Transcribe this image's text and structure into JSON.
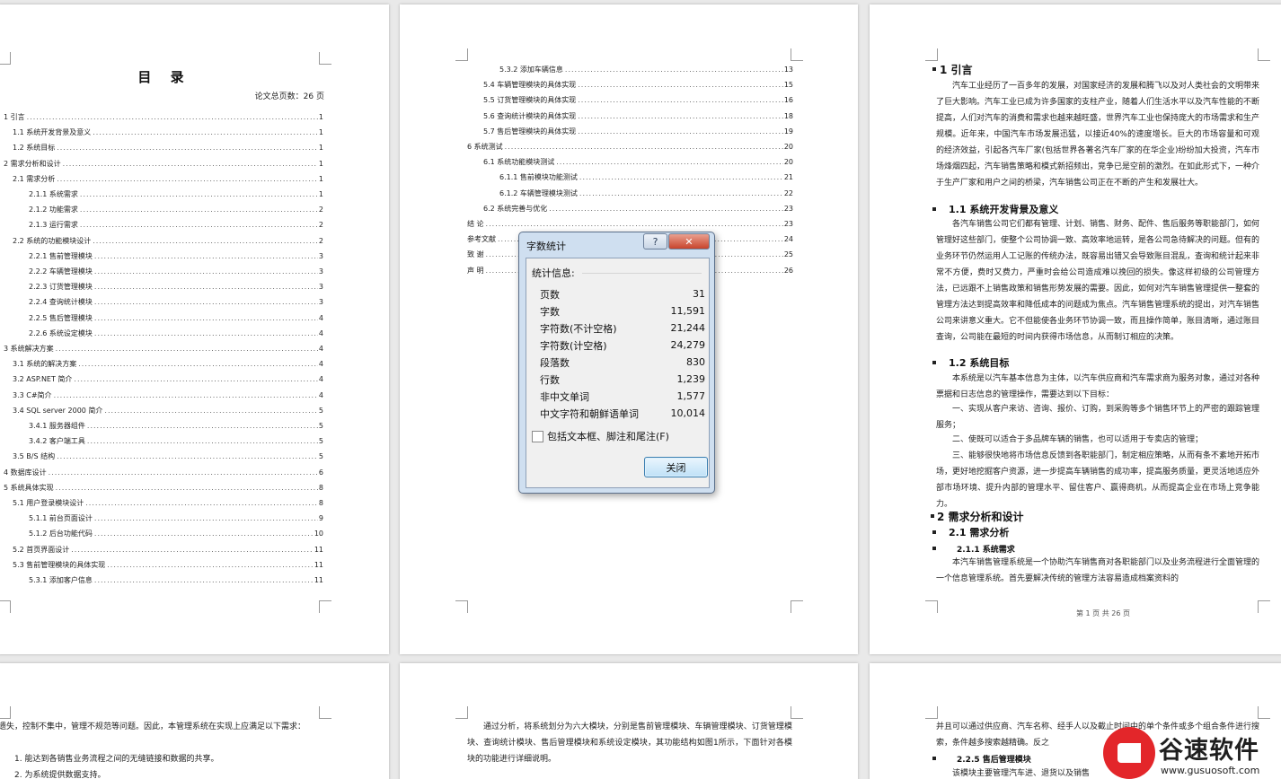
{
  "toc": {
    "title": "目 录",
    "total_pages": "论文总页数：26 页",
    "left_entries": [
      {
        "label": "1 引言",
        "page": "1"
      },
      {
        "label": "1.1 系统开发背景及意义",
        "page": "1"
      },
      {
        "label": "1.2 系统目标",
        "page": "1"
      },
      {
        "label": "2 需求分析和设计",
        "page": "1"
      },
      {
        "label": "2.1 需求分析",
        "page": "1"
      },
      {
        "label": "2.1.1 系统需求",
        "page": "1"
      },
      {
        "label": "2.1.2 功能需求",
        "page": "2"
      },
      {
        "label": "2.1.3 运行需求",
        "page": "2"
      },
      {
        "label": "2.2 系统的功能模块设计",
        "page": "2"
      },
      {
        "label": "2.2.1 售前管理模块",
        "page": "3"
      },
      {
        "label": "2.2.2 车辆管理模块",
        "page": "3"
      },
      {
        "label": "2.2.3 订货管理模块",
        "page": "3"
      },
      {
        "label": "2.2.4 查询统计模块",
        "page": "3"
      },
      {
        "label": "2.2.5 售后管理模块",
        "page": "4"
      },
      {
        "label": "2.2.6 系统设定模块",
        "page": "4"
      },
      {
        "label": "3 系统解决方案",
        "page": "4"
      },
      {
        "label": "3.1 系统的解决方案",
        "page": "4"
      },
      {
        "label": "3.2 ASP.NET 简介",
        "page": "4"
      },
      {
        "label": "3.3 C#简介",
        "page": "4"
      },
      {
        "label": "3.4 SQL server 2000 简介",
        "page": "5"
      },
      {
        "label": "3.4.1 服务器组件",
        "page": "5"
      },
      {
        "label": "3.4.2 客户端工具",
        "page": "5"
      },
      {
        "label": "3.5 B/S 结构",
        "page": "5"
      },
      {
        "label": "4 数据库设计",
        "page": "6"
      },
      {
        "label": "5 系统具体实现",
        "page": "8"
      },
      {
        "label": "5.1 用户登录模块设计",
        "page": "8"
      },
      {
        "label": "5.1.1 前台页面设计",
        "page": "9"
      },
      {
        "label": "5.1.2 后台功能代码",
        "page": "10"
      },
      {
        "label": "5.2 首页界面设计",
        "page": "11"
      },
      {
        "label": "5.3 售前管理模块的具体实现",
        "page": "11"
      },
      {
        "label": "5.3.1 添加客户信息",
        "page": "11"
      }
    ],
    "middle_entries": [
      {
        "label": "5.3.2 添加车辆信息",
        "page": "13"
      },
      {
        "label": "5.4 车辆管理模块的具体实现",
        "page": "15"
      },
      {
        "label": "5.5 订货管理模块的具体实现",
        "page": "16"
      },
      {
        "label": "5.6 查询统计模块的具体实现",
        "page": "18"
      },
      {
        "label": "5.7 售后管理模块的具体实现",
        "page": "19"
      },
      {
        "label": "6 系统测试",
        "page": "20"
      },
      {
        "label": "6.1 系统功能模块测试",
        "page": "20"
      },
      {
        "label": "6.1.1 售前模块功能测试",
        "page": "21"
      },
      {
        "label": "6.1.2 车辆管理模块测试",
        "page": "22"
      },
      {
        "label": "6.2 系统完善与优化",
        "page": "23"
      },
      {
        "label": "结 论",
        "page": "23"
      },
      {
        "label": "参考文献",
        "page": "24"
      },
      {
        "label": "致 谢",
        "page": "25"
      },
      {
        "label": "声 明",
        "page": "26"
      }
    ]
  },
  "body_page": {
    "h_intro": "1 引言",
    "p_intro": "汽车工业经历了一百多年的发展，对国家经济的发展和腾飞以及对人类社会的文明带来了巨大影响。汽车工业已成为许多国家的支柱产业，随着人们生活水平以及汽车性能的不断提高，人们对汽车的消费和需求也越来越旺盛，世界汽车工业也保持庞大的市场需求和生产规模。近年来，中国汽车市场发展迅猛，以接近40%的速度增长。巨大的市场容量和可观的经济效益，引起各汽车厂家(包括世界各著名汽车厂家的在华企业)纷纷加大投资，汽车市场烽烟四起，汽车销售策略和模式新招频出，竞争已是空前的激烈。在如此形式下，一种介于生产厂家和用户之间的桥梁，汽车销售公司正在不断的产生和发展壮大。",
    "h_1_1": "1.1 系统开发背景及意义",
    "p_1_1": "各汽车销售公司它们都有管理、计划、销售、财务、配件、售后服务等职能部门，如何管理好这些部门，使整个公司协调一致、高效率地运转，是各公司急待解决的问题。但有的业务环节仍然运用人工记账的传统办法，既容易出错又会导致账目混乱，查询和统计起来非常不方便，费时又费力，严重时会给公司造成难以挽回的损失。像这样初级的公司管理方法，已远跟不上销售政策和销售形势发展的需要。因此，如何对汽车销售管理提供一整套的管理方法达到提高效率和降低成本的问题成为焦点。汽车销售管理系统的提出，对汽车销售公司来讲意义重大。它不但能使各业务环节协调一致，而且操作简单，账目清晰，通过账目查询，公司能在最短的时间内获得市场信息，从而制订相应的决策。",
    "h_1_2": "1.2 系统目标",
    "p_1_2a": "本系统是以汽车基本信息为主体，以汽车供应商和汽车需求商为服务对象，通过对各种票据和日志信息的管理操作，需要达到以下目标：",
    "p_1_2b": "一、实现从客户来访、咨询、报价、订购，到采购等多个销售环节上的严密的跟踪管理服务；",
    "p_1_2c": "二、使既可以适合于多品牌车辆的销售，也可以适用于专卖店的管理；",
    "p_1_2d": "三、能够很快地将市场信息反馈到各职能部门，制定相应策略，从而有条不紊地开拓市场，更好地挖掘客户资源，进一步提高车辆销售的成功率，提高服务质量，更灵活地适应外部市场环境、提升内部的管理水平、留住客户、赢得商机，从而提高企业在市场上竞争能力。",
    "h_2": "2 需求分析和设计",
    "h_2_1": "2.1 需求分析",
    "h_2_1_1": "2.1.1 系统需求",
    "p_2_1_1": "本汽车销售管理系统是一个协助汽车销售商对各职能部门以及业务流程进行全面管理的一个信息管理系统。首先要解决传统的管理方法容易造成档案资料的",
    "footer": "第 1 页 共 26 页"
  },
  "bottom_pages": {
    "left_text_1": "遗失，控制不集中，管理不规范等问题。因此，本管理系统在实现上应满足以下需求：",
    "left_text_2": "1. 能达到各销售业务流程之间的无缝链接和数据的共享。",
    "left_text_3": "2. 为系统提供数据支持。",
    "middle_text": "通过分析，将系统划分为六大模块，分别是售前管理模块、车辆管理模块、订货管理模块、查询统计模块、售后管理模块和系统设定模块，其功能结构如图1所示，下面针对各模块的功能进行详细说明。",
    "right_text_1": "并且可以通过供应商、汽车名称、经手人以及截止时间中的单个条件或多个组合条件进行搜索，条件越多搜索越精确。反之",
    "right_heading": "2.2.5 售后管理模块",
    "right_text_2": "该模块主要管理汽车进、退货以及销售"
  },
  "dialog": {
    "title": "字数统计",
    "help_label": "?",
    "close_x": "✕",
    "section_label": "统计信息:",
    "stats": [
      {
        "label": "页数",
        "value": "31"
      },
      {
        "label": "字数",
        "value": "11,591"
      },
      {
        "label": "字符数(不计空格)",
        "value": "21,244"
      },
      {
        "label": "字符数(计空格)",
        "value": "24,279"
      },
      {
        "label": "段落数",
        "value": "830"
      },
      {
        "label": "行数",
        "value": "1,239"
      },
      {
        "label": "非中文单词",
        "value": "1,577"
      },
      {
        "label": "中文字符和朝鲜语单词",
        "value": "10,014"
      }
    ],
    "checkbox_label": "包括文本框、脚注和尾注(F)",
    "close_button": "关闭"
  },
  "logo": {
    "name": "谷速软件",
    "url": "www.gusuosoft.com"
  }
}
